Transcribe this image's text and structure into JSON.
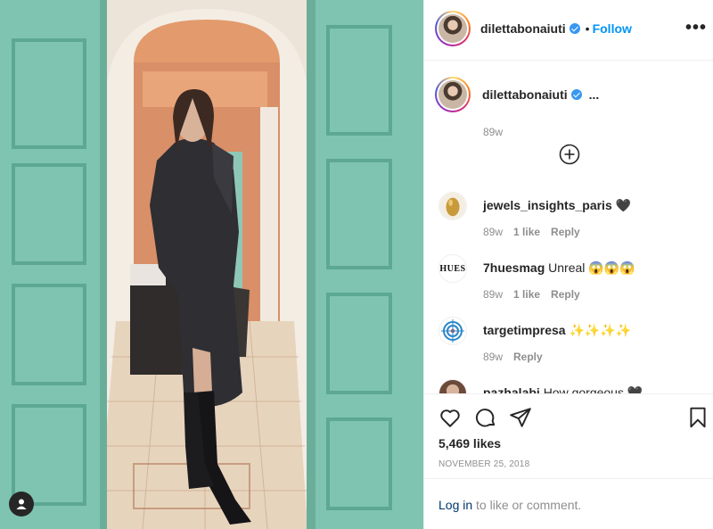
{
  "post": {
    "author": "dilettabonaiuti",
    "follow_label": "Follow",
    "dot": "•",
    "more_label": "•••",
    "caption_ellipsis": "...",
    "caption_time": "89w"
  },
  "comments": [
    {
      "user": "jewels_insights_paris",
      "text": "🖤",
      "time": "89w",
      "likes": "1 like",
      "reply": "Reply"
    },
    {
      "user": "7huesmag",
      "text": "Unreal 😱😱😱",
      "time": "89w",
      "likes": "1 like",
      "reply": "Reply",
      "avatar_text": "HUES"
    },
    {
      "user": "targetimpresa",
      "text": "✨✨✨✨",
      "time": "89w",
      "likes": "",
      "reply": "Reply"
    },
    {
      "user": "pazhalabi",
      "text": "How gorgeous 🖤",
      "time": "",
      "likes": "",
      "reply": ""
    }
  ],
  "stats": {
    "likes": "5,469 likes",
    "date": "NOVEMBER 25, 2018"
  },
  "login": {
    "link": "Log in",
    "rest": " to like or comment."
  },
  "colors": {
    "accent": "#0095f6",
    "verified": "#3897f0",
    "muted": "#8e8e8e",
    "door_teal": "#7fc4b0",
    "wall_terracotta": "#d98f67"
  }
}
